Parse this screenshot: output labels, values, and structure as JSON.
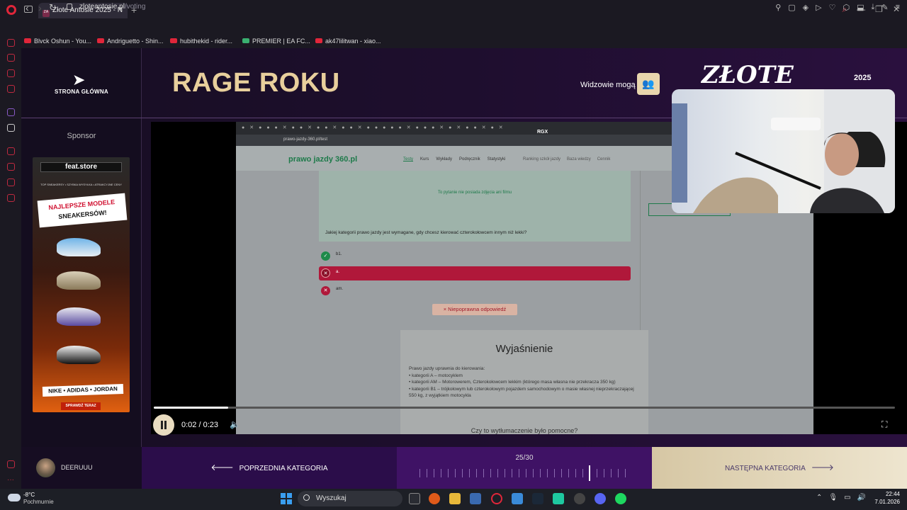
{
  "browser": {
    "tab_title": "Złote Antosie 2025 - N",
    "tab_favicon": "ZA",
    "url_domain": "zloteantosie.pl",
    "url_path": "/voting",
    "bookmarks": [
      "Blvck Oshun - You...",
      "Andriguetto - Shin...",
      "hubithekid - rider...",
      "PREMIER | EA FC...",
      "ak47lilitwan - xiao..."
    ]
  },
  "sidebar": {
    "home_label": "STRONA GŁÓWNA",
    "sponsor_label": "Sponsor"
  },
  "ad": {
    "brand": "feat.store",
    "tagline": "TOP SNEAKERSY • SZYBKA WYSYŁKA • ATRAKCYJNE CENY",
    "headline_line1": "NAJLEPSZE MODELE",
    "headline_line2": "SNEAKERSÓW!",
    "brands": "NIKE • ADIDAS • JORDAN",
    "cta": "SPRAWDŹ TERAZ"
  },
  "header": {
    "category_title": "RAGE ROKU",
    "viewers_label": "Widzowie mogą",
    "logo_text": "ZŁOTE",
    "logo_year": "2025"
  },
  "video_content": {
    "rgx": "RGX",
    "url": "prawo-jazdy-360.pl/test",
    "site_logo": "prawo jazdy 360.pl",
    "menu": [
      "Testy",
      "Kurs",
      "Wykłady",
      "Podręcznik",
      "Statystyki"
    ],
    "menu2": [
      "Ranking szkół jazdy",
      "Baza wiedzy",
      "Cennik"
    ],
    "no_image": "To pytanie nie posiada zdjęcia ani filmu",
    "question": "Jakiej kategorii prawo jazdy jest wymagane, gdy chcesz kierować czterokołowcem innym niż lekki?",
    "answers": [
      "b1.",
      "a.",
      "am."
    ],
    "feedback": "× Niepoprawna odpowiedź",
    "explanation_title": "Wyjaśnienie",
    "explanation_lines": [
      "Prawo jazdy uprawnia do kierowania:",
      "• kategorii A – motocyklem",
      "• kategorii AM – Motorowerem, Czterokołowcem lekkim (którego masa własna nie przekracza 350 kg)",
      "• kategorii B1 – trójkołowym lub czterokołowym pojazdem samochodowym o masie własnej nieprzekraczającej 550 kg, z wyjątkiem motocykla"
    ],
    "helpful": "Czy to wytłumaczenie było pomocne?",
    "side_button": "Zobacz wyj..."
  },
  "player": {
    "time": "0:02 / 0:23",
    "progress": 0.1
  },
  "bottom": {
    "username": "DEERUUU",
    "prev_label": "POPRZEDNIA KATEGORIA",
    "next_label": "NASTĘPNA KATEGORIA",
    "category_position": "25/30",
    "current_index": 25,
    "total": 30
  },
  "taskbar": {
    "temp": "-8°C",
    "weather": "Pochmurnie",
    "search_label": "Wyszukaj",
    "time": "22:44",
    "date": "7.01.2026"
  },
  "colors": {
    "accent_gold": "#e8cf9c",
    "purple": "#3f1265",
    "wrong_red": "#b0183a",
    "correct_green": "#1e8a4a"
  }
}
